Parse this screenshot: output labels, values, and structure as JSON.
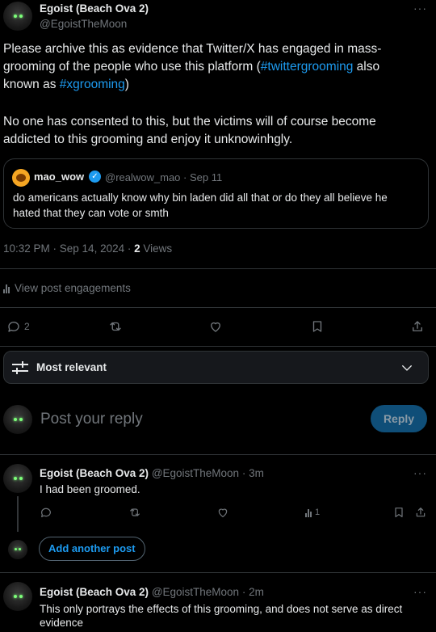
{
  "main_post": {
    "author_name": "Egoist (Beach Ova 2)",
    "author_handle": "@EgoistTheMoon",
    "text_lines": [
      "Please archive this as evidence that Twitter/X has engaged in mass-",
      "grooming of the people who use this platform ("
    ],
    "hashtag1": "#twittergrooming",
    "text_also": " also",
    "text_known": "known as ",
    "hashtag2": "#xgrooming",
    "text_close": ")",
    "paragraph2_line1": "No one has consented to this, but the victims will of course become",
    "paragraph2_line2": "addicted to this grooming and enjoy it unknowinhgly.",
    "timestamp": "10:32 PM · Sep 14, 2024 · ",
    "views_count": "2",
    "views_label": " Views",
    "engagements_label": "View post engagements",
    "reply_count": "2"
  },
  "quoted": {
    "name": "mao_wow",
    "handle": "@realwow_mao · Sep 11",
    "line1": "do americans actually know why bin laden did all that or do they all believe he",
    "line2": "hated that they can vote or smth"
  },
  "sort": {
    "label": "Most relevant"
  },
  "reply_box": {
    "placeholder": "Post your reply",
    "button": "Reply"
  },
  "replies": [
    {
      "name": "Egoist (Beach Ova 2)",
      "meta": "@EgoistTheMoon · 3m",
      "text": "I had been groomed.",
      "views": "1"
    },
    {
      "name": "Egoist (Beach Ova 2)",
      "meta": "@EgoistTheMoon · 2m",
      "text_line1": "This only portrays the effects of this grooming, and does not serve as direct",
      "text_line2": "evidence"
    }
  ],
  "add_another": "Add another post",
  "colors": {
    "accent": "#1d9bf0",
    "muted": "#71767b",
    "border": "#2f3336"
  }
}
